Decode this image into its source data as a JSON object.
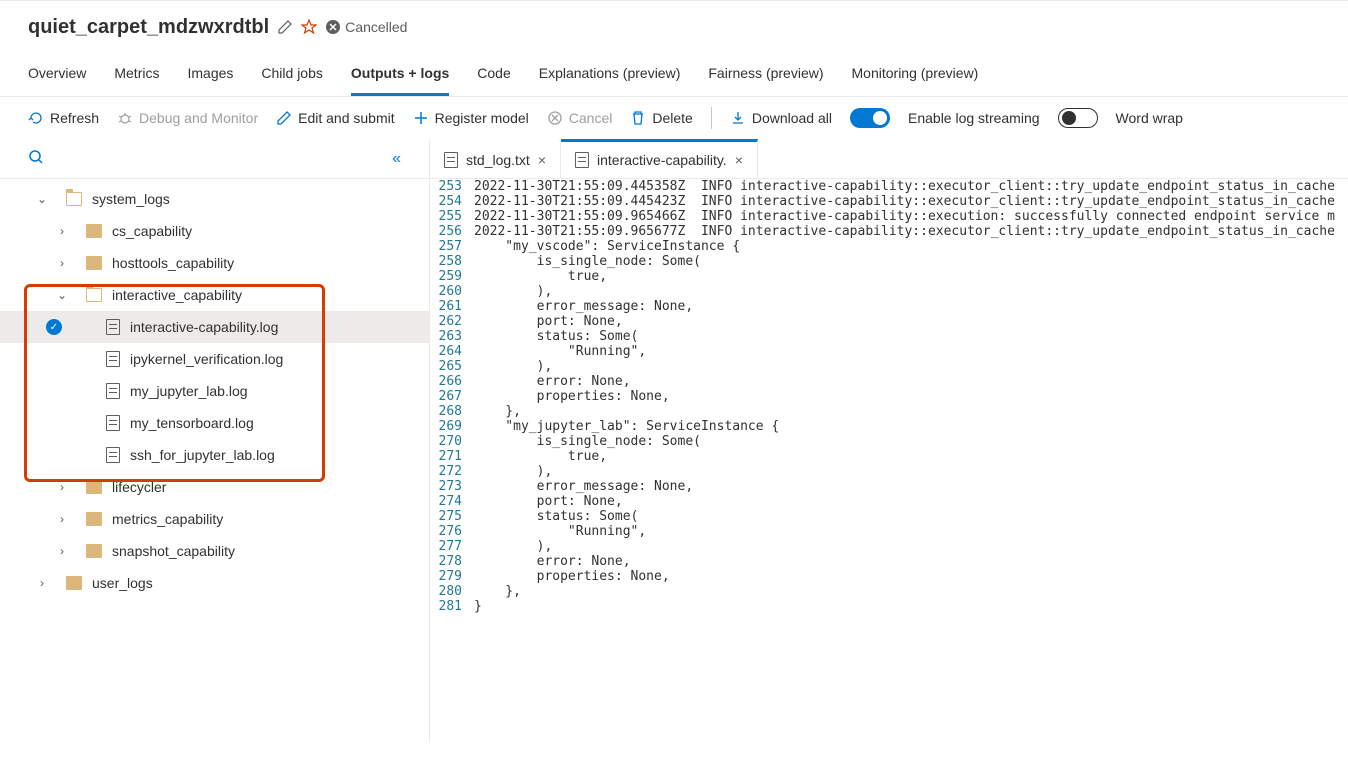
{
  "header": {
    "title": "quiet_carpet_mdzwxrdtbl",
    "status": "Cancelled"
  },
  "tabs": [
    {
      "label": "Overview"
    },
    {
      "label": "Metrics"
    },
    {
      "label": "Images"
    },
    {
      "label": "Child jobs"
    },
    {
      "label": "Outputs + logs",
      "active": true
    },
    {
      "label": "Code"
    },
    {
      "label": "Explanations (preview)"
    },
    {
      "label": "Fairness (preview)"
    },
    {
      "label": "Monitoring (preview)"
    }
  ],
  "toolbar": {
    "refresh": "Refresh",
    "debug": "Debug and Monitor",
    "edit": "Edit and submit",
    "register": "Register model",
    "cancel": "Cancel",
    "delete": "Delete",
    "download": "Download all",
    "log_stream": "Enable log streaming",
    "word_wrap": "Word wrap"
  },
  "tree": {
    "root1": "system_logs",
    "folders": [
      "cs_capability",
      "hosttools_capability",
      "interactive_capability",
      "lifecycler",
      "metrics_capability",
      "snapshot_capability"
    ],
    "interactive_files": [
      "interactive-capability.log",
      "ipykernel_verification.log",
      "my_jupyter_lab.log",
      "my_tensorboard.log",
      "ssh_for_jupyter_lab.log"
    ],
    "root2": "user_logs"
  },
  "editor": {
    "tabs": [
      {
        "label": "std_log.txt"
      },
      {
        "label": "interactive-capability.",
        "active": true
      }
    ],
    "lines": [
      {
        "n": 253,
        "t": "2022-11-30T21:55:09.445358Z  INFO interactive-capability::executor_client::try_update_endpoint_status_in_cache"
      },
      {
        "n": 254,
        "t": "2022-11-30T21:55:09.445423Z  INFO interactive-capability::executor_client::try_update_endpoint_status_in_cache"
      },
      {
        "n": 255,
        "t": "2022-11-30T21:55:09.965466Z  INFO interactive-capability::execution: successfully connected endpoint service m"
      },
      {
        "n": 256,
        "t": "2022-11-30T21:55:09.965677Z  INFO interactive-capability::executor_client::try_update_endpoint_status_in_cache"
      },
      {
        "n": 257,
        "t": "    \"my_vscode\": ServiceInstance {"
      },
      {
        "n": 258,
        "t": "        is_single_node: Some("
      },
      {
        "n": 259,
        "t": "            true,"
      },
      {
        "n": 260,
        "t": "        ),"
      },
      {
        "n": 261,
        "t": "        error_message: None,"
      },
      {
        "n": 262,
        "t": "        port: None,"
      },
      {
        "n": 263,
        "t": "        status: Some("
      },
      {
        "n": 264,
        "t": "            \"Running\","
      },
      {
        "n": 265,
        "t": "        ),"
      },
      {
        "n": 266,
        "t": "        error: None,"
      },
      {
        "n": 267,
        "t": "        properties: None,"
      },
      {
        "n": 268,
        "t": "    },"
      },
      {
        "n": 269,
        "t": "    \"my_jupyter_lab\": ServiceInstance {"
      },
      {
        "n": 270,
        "t": "        is_single_node: Some("
      },
      {
        "n": 271,
        "t": "            true,"
      },
      {
        "n": 272,
        "t": "        ),"
      },
      {
        "n": 273,
        "t": "        error_message: None,"
      },
      {
        "n": 274,
        "t": "        port: None,"
      },
      {
        "n": 275,
        "t": "        status: Some("
      },
      {
        "n": 276,
        "t": "            \"Running\","
      },
      {
        "n": 277,
        "t": "        ),"
      },
      {
        "n": 278,
        "t": "        error: None,"
      },
      {
        "n": 279,
        "t": "        properties: None,"
      },
      {
        "n": 280,
        "t": "    },"
      },
      {
        "n": 281,
        "t": "}"
      }
    ]
  }
}
